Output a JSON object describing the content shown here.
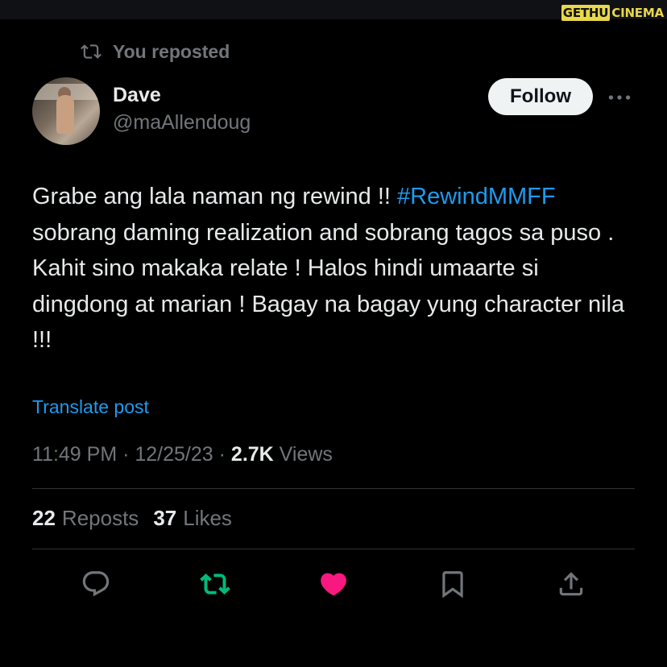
{
  "watermark": {
    "part1": "GETHU",
    "part2": "CINEMA"
  },
  "repost_banner": {
    "label": "You reposted"
  },
  "author": {
    "name": "Dave",
    "handle": "@maAllendoug"
  },
  "follow_label": "Follow",
  "tweet": {
    "text_before": "Grabe ang lala naman ng rewind !! ",
    "hashtag": "#RewindMMFF",
    "text_after": " sobrang daming realization and sobrang tagos sa puso . Kahit sino makaka relate ! Halos hindi umaarte si dingdong at marian ! Bagay na bagay yung character nila !!!"
  },
  "translate_label": "Translate post",
  "meta": {
    "time": "11:49 PM",
    "sep1": " · ",
    "date": "12/25/23",
    "sep2": " · ",
    "views_count": "2.7K",
    "views_label": " Views"
  },
  "stats": {
    "reposts_count": "22",
    "reposts_label": "Reposts",
    "likes_count": "37",
    "likes_label": "Likes"
  },
  "icons": {
    "reply": "speech-bubble-icon",
    "repost": "repost-arrows-icon",
    "like": "heart-icon",
    "bookmark": "bookmark-icon",
    "share": "share-upload-icon",
    "more": "ellipsis-icon"
  },
  "colors": {
    "background": "#000000",
    "text": "#e7e9ea",
    "muted": "#71767b",
    "link": "#1d9bf0",
    "repost_active": "#00ba7c",
    "like_active": "#f91880",
    "follow_bg": "#eff3f4"
  }
}
